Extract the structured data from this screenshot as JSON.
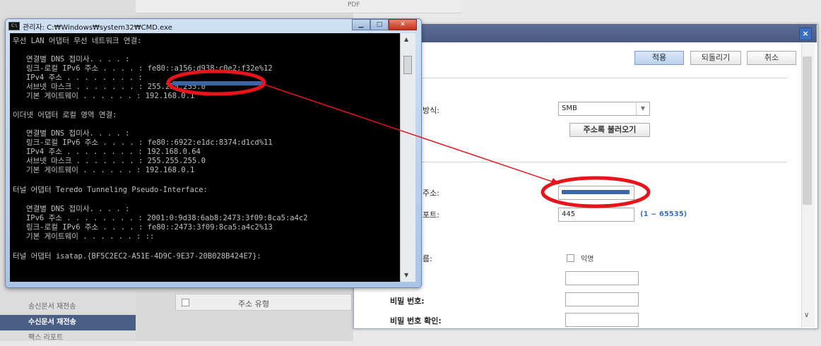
{
  "background": {
    "top_label": "PDF",
    "sidebar": [
      {
        "label": "송신문서 재전송",
        "active": false
      },
      {
        "label": "수신문서 재전송",
        "active": true
      },
      {
        "label": "팩스 리포트",
        "active": false
      }
    ],
    "table_header": {
      "column": "주소 유형"
    }
  },
  "dialog": {
    "buttons": {
      "apply": "적용",
      "revert": "되돌리기",
      "cancel": "취소"
    },
    "close_glyph": "×",
    "labels": {
      "method": "방식:",
      "address": "주소:",
      "port": "포트:",
      "name": "름:",
      "password": "비밀 번호:",
      "password_confirm": "비밀 번호 확인:"
    },
    "method_value": "SMB",
    "address_book_button": "주소록 불러오기",
    "port_value": "445",
    "port_range": "(1 ~ 65535)",
    "anonymous_label": "익명"
  },
  "cmd": {
    "title": "관리자: C:₩Windows₩system32₩CMD.exe",
    "lines": [
      "무선 LAN 어댑터 무선 네트워크 연결:",
      "",
      "   연결별 DNS 접미사. . . . :",
      "   링크-로컬 IPv6 주소 . . . . : fe80::a156:d938:c0e2:f32e%12",
      "   IPv4 주소 . . . . . . . . :",
      "   서브넷 마스크 . . . . . . . : 255.255.255.0",
      "   기본 게이트웨이 . . . . . . : 192.168.0.1",
      "",
      "이더넷 어댑터 로컬 영역 연결:",
      "",
      "   연결별 DNS 접미사. . . . :",
      "   링크-로컬 IPv6 주소 . . . . : fe80::6922:e1dc:8374:d1cd%11",
      "   IPv4 주소 . . . . . . . . : 192.168.0.64",
      "   서브넷 마스크 . . . . . . . : 255.255.255.0",
      "   기본 게이트웨이 . . . . . . : 192.168.0.1",
      "",
      "터널 어댑터 Teredo Tunneling Pseudo-Interface:",
      "",
      "   연결별 DNS 접미사. . . . :",
      "   IPv6 주소 . . . . . . . . : 2001:0:9d38:6ab8:2473:3f09:8ca5:a4c2",
      "   링크-로컬 IPv6 주소 . . . . : fe80::2473:3f09:8ca5:a4c2%13",
      "   기본 게이트웨이 . . . . . . : ::",
      "",
      "터널 어댑터 isatap.{BF5C2EC2-A51E-4D9C-9E37-20B028B424E7}:"
    ]
  },
  "colors": {
    "annotation_red": "#e8141c",
    "redacted_blue": "#3b65a6",
    "dialog_title": "#4f6089",
    "sidebar_active": "#4a5f85"
  }
}
